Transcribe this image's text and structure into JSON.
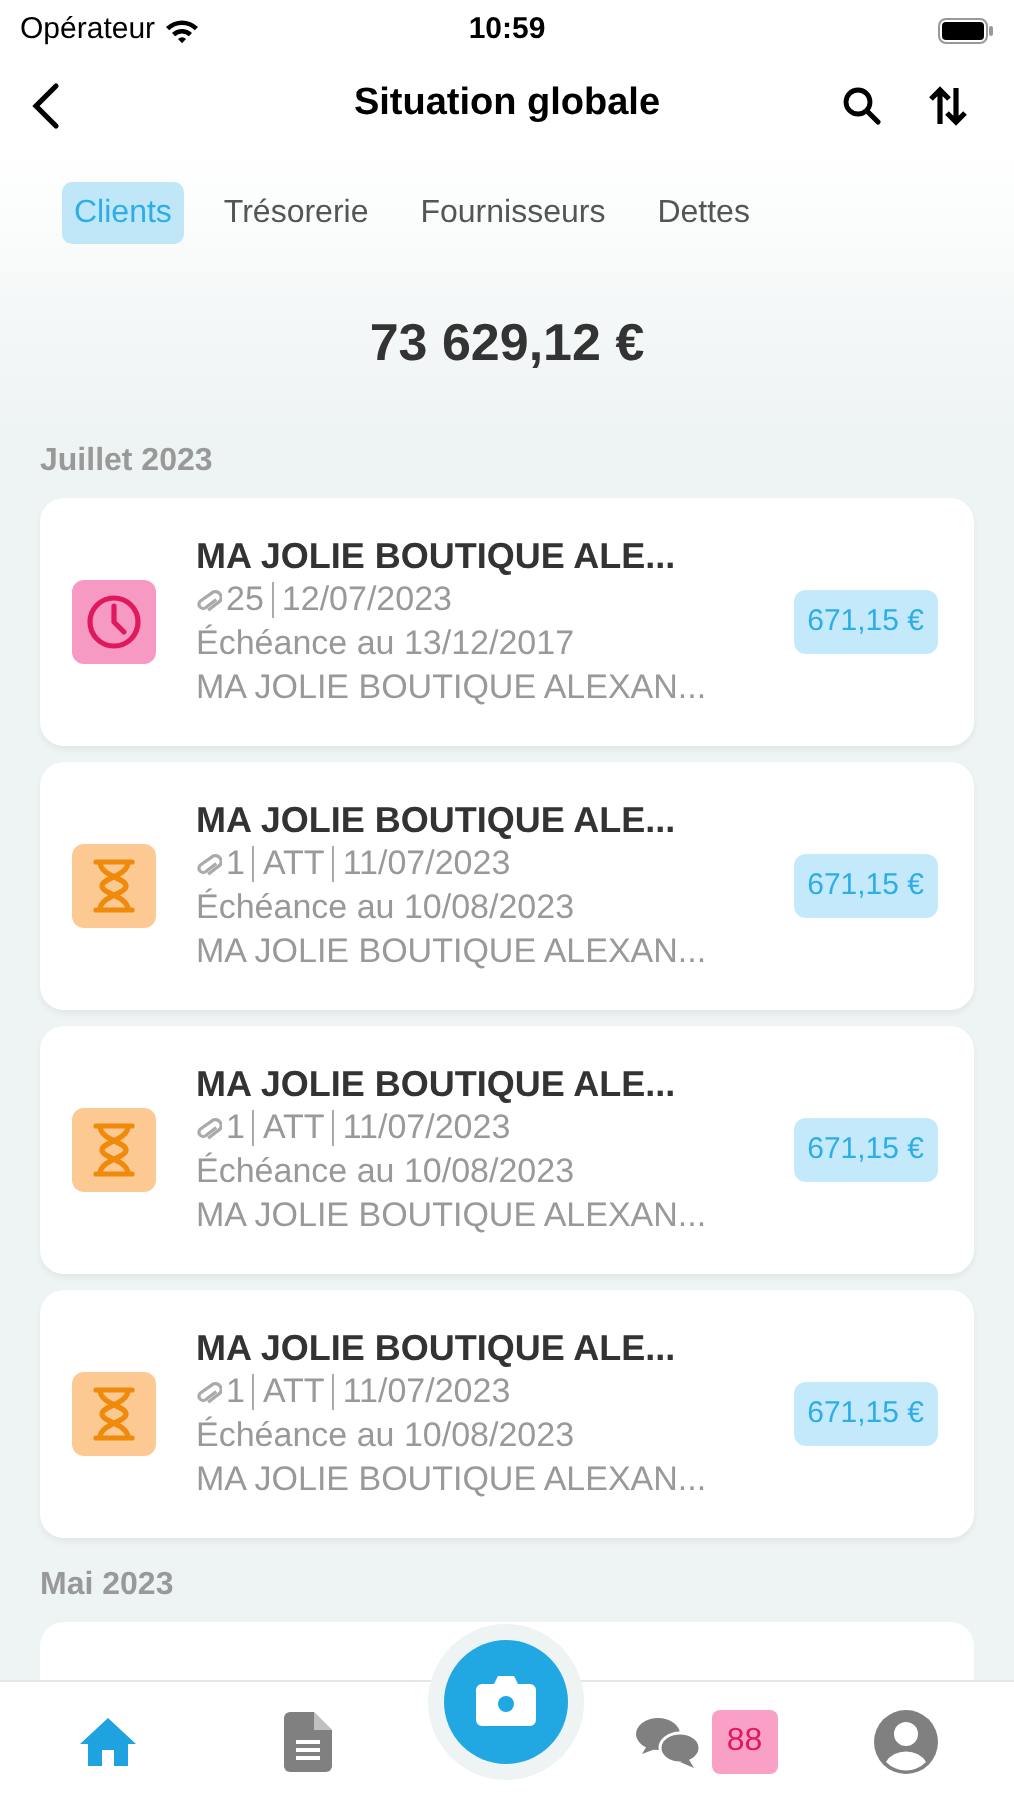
{
  "status_bar": {
    "carrier": "Opérateur",
    "time": "10:59"
  },
  "nav": {
    "title": "Situation globale"
  },
  "tabs": [
    {
      "label": "Clients",
      "selected": true
    },
    {
      "label": "Trésorerie",
      "selected": false
    },
    {
      "label": "Fournisseurs",
      "selected": false
    },
    {
      "label": "Dettes",
      "selected": false
    }
  ],
  "total": "73 629,12 €",
  "sections": [
    {
      "title": "Juillet 2023",
      "items": [
        {
          "kind": "clock",
          "title": "MA JOLIE BOUTIQUE ALE...",
          "attachments": "25",
          "date": "12/07/2023",
          "due": "Échéance au 13/12/2017",
          "subtitle": "MA JOLIE BOUTIQUE ALEXAN...",
          "amount": "671,15 €"
        },
        {
          "kind": "hourglass",
          "title": "MA JOLIE BOUTIQUE ALE...",
          "attachments": "1",
          "status": "ATT",
          "date": "11/07/2023",
          "due": "Échéance au 10/08/2023",
          "subtitle": "MA JOLIE BOUTIQUE ALEXAN...",
          "amount": "671,15 €"
        },
        {
          "kind": "hourglass",
          "title": "MA JOLIE BOUTIQUE ALE...",
          "attachments": "1",
          "status": "ATT",
          "date": "11/07/2023",
          "due": "Échéance au 10/08/2023",
          "subtitle": "MA JOLIE BOUTIQUE ALEXAN...",
          "amount": "671,15 €"
        },
        {
          "kind": "hourglass",
          "title": "MA JOLIE BOUTIQUE ALE...",
          "attachments": "1",
          "status": "ATT",
          "date": "11/07/2023",
          "due": "Échéance au 10/08/2023",
          "subtitle": "MA JOLIE BOUTIQUE ALEXAN...",
          "amount": "671,15 €"
        }
      ]
    },
    {
      "title": "Mai 2023"
    }
  ],
  "bottom_nav": [
    {
      "kind": "home",
      "selected": true
    },
    {
      "kind": "document",
      "selected": false
    },
    {
      "kind": "camera",
      "selected": false
    },
    {
      "kind": "chat",
      "selected": false,
      "badge": "88"
    },
    {
      "kind": "profile",
      "selected": false
    }
  ]
}
